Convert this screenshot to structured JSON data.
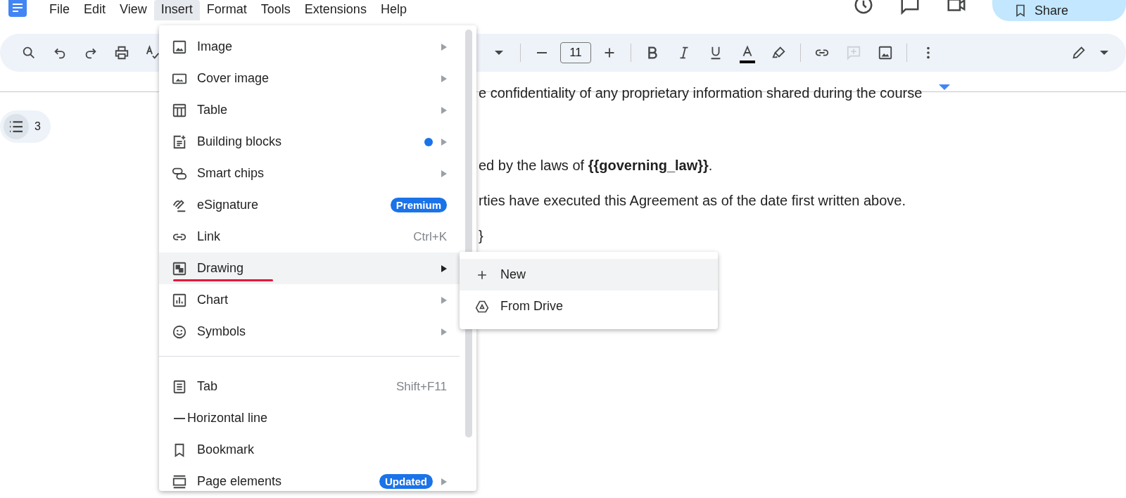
{
  "menu_bar": [
    {
      "label": "File",
      "selected": false
    },
    {
      "label": "Edit",
      "selected": false
    },
    {
      "label": "View",
      "selected": false
    },
    {
      "label": "Insert",
      "selected": true
    },
    {
      "label": "Format",
      "selected": false
    },
    {
      "label": "Tools",
      "selected": false
    },
    {
      "label": "Extensions",
      "selected": false
    },
    {
      "label": "Help",
      "selected": false
    }
  ],
  "share_button": {
    "label": "Share"
  },
  "toolbar_left": [
    {
      "kind": "search"
    },
    {
      "kind": "undo"
    },
    {
      "kind": "redo"
    },
    {
      "kind": "print"
    },
    {
      "kind": "spellcheck"
    }
  ],
  "toolbar": [
    {
      "kind": "caret"
    },
    {
      "kind": "divider"
    },
    {
      "kind": "minus"
    },
    {
      "kind": "font_size",
      "value": "11"
    },
    {
      "kind": "plus"
    },
    {
      "kind": "divider"
    },
    {
      "kind": "bold"
    },
    {
      "kind": "italic"
    },
    {
      "kind": "underline"
    },
    {
      "kind": "text_color",
      "color": "#000000"
    },
    {
      "kind": "highlight"
    },
    {
      "kind": "divider"
    },
    {
      "kind": "link"
    },
    {
      "kind": "comment",
      "disabled": true
    },
    {
      "kind": "image"
    },
    {
      "kind": "divider"
    },
    {
      "kind": "more"
    }
  ],
  "toolbar_right": [
    {
      "kind": "pen"
    },
    {
      "kind": "caret"
    }
  ],
  "outline": {
    "count": "3"
  },
  "document": {
    "lines": [
      "e confidentiality of any proprietary information shared during the course",
      "ed by the laws of **{{governing_law}}**.",
      "rties have executed this Agreement as of the date first written above.",
      "}"
    ]
  },
  "insert_menu": {
    "items": [
      {
        "kind": "image",
        "label": "Image",
        "submenu": true,
        "selected": false
      },
      {
        "kind": "cover_image",
        "label": "Cover image",
        "submenu": true,
        "selected": false
      },
      {
        "kind": "table",
        "label": "Table",
        "submenu": true,
        "selected": false
      },
      {
        "kind": "building_blocks",
        "label": "Building blocks",
        "submenu": true,
        "dot": true,
        "selected": false
      },
      {
        "kind": "smart_chips",
        "label": "Smart chips",
        "submenu": true,
        "selected": false
      },
      {
        "kind": "esignature",
        "label": "eSignature",
        "badge": "Premium",
        "selected": false
      },
      {
        "kind": "link",
        "label": "Link",
        "shortcut": "Ctrl+K",
        "selected": false
      },
      {
        "kind": "drawing",
        "label": "Drawing",
        "submenu": true,
        "selected": true,
        "underlined": true
      },
      {
        "kind": "chart",
        "label": "Chart",
        "submenu": true,
        "selected": false
      },
      {
        "kind": "symbols",
        "label": "Symbols",
        "submenu": true,
        "selected": false
      },
      {
        "kind": "divider"
      },
      {
        "kind": "tab",
        "label": "Tab",
        "shortcut": "Shift+F11",
        "selected": false
      },
      {
        "kind": "horizontal_line",
        "label": "Horizontal line",
        "selected": false
      },
      {
        "kind": "bookmark",
        "label": "Bookmark",
        "selected": false
      },
      {
        "kind": "page_elements",
        "label": "Page elements",
        "badge": "Updated",
        "submenu": true,
        "selected": false
      }
    ]
  },
  "drawing_submenu": {
    "items": [
      {
        "kind": "plus",
        "label": "New",
        "selected": true
      },
      {
        "kind": "drive",
        "label": "From Drive",
        "selected": false
      }
    ]
  }
}
